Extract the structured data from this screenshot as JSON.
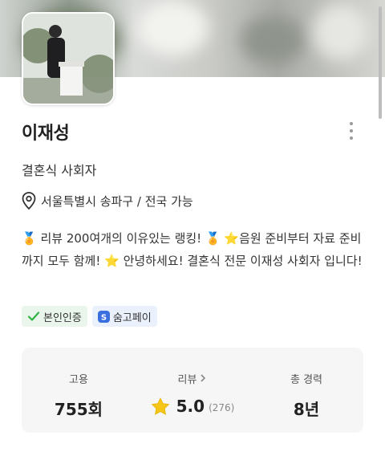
{
  "profile": {
    "name": "이재성",
    "job": "결혼식 사회자",
    "location": "서울특별시 송파구 / 전국 가능",
    "intro": "🏅 리뷰 200여개의 이유있는 랭킹! 🏅 ⭐음원 준비부터 자료 준비까지 모두 함께! ⭐ 안녕하세요! 결혼식 전문 이재성 사회자 입니다!"
  },
  "badges": [
    {
      "label": "본인인증",
      "icon": "check-icon",
      "color": "#2fb344"
    },
    {
      "label": "숨고페이",
      "icon": "pay-icon",
      "color": "#3b6fe0"
    }
  ],
  "stats": {
    "hires": {
      "label": "고용",
      "value": "755회"
    },
    "reviews": {
      "label": "리뷰",
      "value": "5.0",
      "count": "(276)"
    },
    "career": {
      "label": "총 경력",
      "value": "8년"
    }
  },
  "colors": {
    "star": "#f5c518",
    "verified": "#2fb344",
    "pay": "#3b6fe0"
  }
}
